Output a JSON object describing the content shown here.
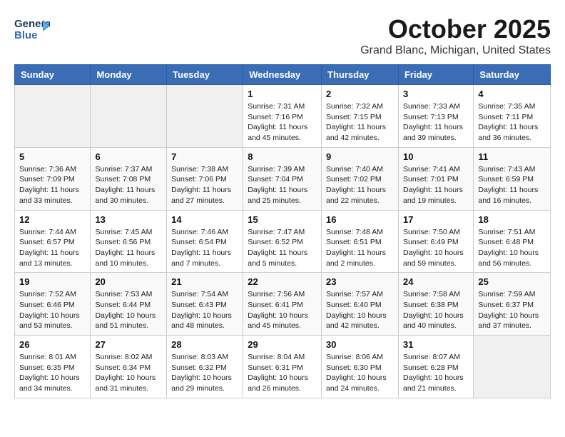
{
  "logo": {
    "line1": "General",
    "line2": "Blue"
  },
  "header": {
    "month": "October 2025",
    "location": "Grand Blanc, Michigan, United States"
  },
  "weekdays": [
    "Sunday",
    "Monday",
    "Tuesday",
    "Wednesday",
    "Thursday",
    "Friday",
    "Saturday"
  ],
  "weeks": [
    [
      {
        "day": "",
        "info": ""
      },
      {
        "day": "",
        "info": ""
      },
      {
        "day": "",
        "info": ""
      },
      {
        "day": "1",
        "info": "Sunrise: 7:31 AM\nSunset: 7:16 PM\nDaylight: 11 hours\nand 45 minutes."
      },
      {
        "day": "2",
        "info": "Sunrise: 7:32 AM\nSunset: 7:15 PM\nDaylight: 11 hours\nand 42 minutes."
      },
      {
        "day": "3",
        "info": "Sunrise: 7:33 AM\nSunset: 7:13 PM\nDaylight: 11 hours\nand 39 minutes."
      },
      {
        "day": "4",
        "info": "Sunrise: 7:35 AM\nSunset: 7:11 PM\nDaylight: 11 hours\nand 36 minutes."
      }
    ],
    [
      {
        "day": "5",
        "info": "Sunrise: 7:36 AM\nSunset: 7:09 PM\nDaylight: 11 hours\nand 33 minutes."
      },
      {
        "day": "6",
        "info": "Sunrise: 7:37 AM\nSunset: 7:08 PM\nDaylight: 11 hours\nand 30 minutes."
      },
      {
        "day": "7",
        "info": "Sunrise: 7:38 AM\nSunset: 7:06 PM\nDaylight: 11 hours\nand 27 minutes."
      },
      {
        "day": "8",
        "info": "Sunrise: 7:39 AM\nSunset: 7:04 PM\nDaylight: 11 hours\nand 25 minutes."
      },
      {
        "day": "9",
        "info": "Sunrise: 7:40 AM\nSunset: 7:02 PM\nDaylight: 11 hours\nand 22 minutes."
      },
      {
        "day": "10",
        "info": "Sunrise: 7:41 AM\nSunset: 7:01 PM\nDaylight: 11 hours\nand 19 minutes."
      },
      {
        "day": "11",
        "info": "Sunrise: 7:43 AM\nSunset: 6:59 PM\nDaylight: 11 hours\nand 16 minutes."
      }
    ],
    [
      {
        "day": "12",
        "info": "Sunrise: 7:44 AM\nSunset: 6:57 PM\nDaylight: 11 hours\nand 13 minutes."
      },
      {
        "day": "13",
        "info": "Sunrise: 7:45 AM\nSunset: 6:56 PM\nDaylight: 11 hours\nand 10 minutes."
      },
      {
        "day": "14",
        "info": "Sunrise: 7:46 AM\nSunset: 6:54 PM\nDaylight: 11 hours\nand 7 minutes."
      },
      {
        "day": "15",
        "info": "Sunrise: 7:47 AM\nSunset: 6:52 PM\nDaylight: 11 hours\nand 5 minutes."
      },
      {
        "day": "16",
        "info": "Sunrise: 7:48 AM\nSunset: 6:51 PM\nDaylight: 11 hours\nand 2 minutes."
      },
      {
        "day": "17",
        "info": "Sunrise: 7:50 AM\nSunset: 6:49 PM\nDaylight: 10 hours\nand 59 minutes."
      },
      {
        "day": "18",
        "info": "Sunrise: 7:51 AM\nSunset: 6:48 PM\nDaylight: 10 hours\nand 56 minutes."
      }
    ],
    [
      {
        "day": "19",
        "info": "Sunrise: 7:52 AM\nSunset: 6:46 PM\nDaylight: 10 hours\nand 53 minutes."
      },
      {
        "day": "20",
        "info": "Sunrise: 7:53 AM\nSunset: 6:44 PM\nDaylight: 10 hours\nand 51 minutes."
      },
      {
        "day": "21",
        "info": "Sunrise: 7:54 AM\nSunset: 6:43 PM\nDaylight: 10 hours\nand 48 minutes."
      },
      {
        "day": "22",
        "info": "Sunrise: 7:56 AM\nSunset: 6:41 PM\nDaylight: 10 hours\nand 45 minutes."
      },
      {
        "day": "23",
        "info": "Sunrise: 7:57 AM\nSunset: 6:40 PM\nDaylight: 10 hours\nand 42 minutes."
      },
      {
        "day": "24",
        "info": "Sunrise: 7:58 AM\nSunset: 6:38 PM\nDaylight: 10 hours\nand 40 minutes."
      },
      {
        "day": "25",
        "info": "Sunrise: 7:59 AM\nSunset: 6:37 PM\nDaylight: 10 hours\nand 37 minutes."
      }
    ],
    [
      {
        "day": "26",
        "info": "Sunrise: 8:01 AM\nSunset: 6:35 PM\nDaylight: 10 hours\nand 34 minutes."
      },
      {
        "day": "27",
        "info": "Sunrise: 8:02 AM\nSunset: 6:34 PM\nDaylight: 10 hours\nand 31 minutes."
      },
      {
        "day": "28",
        "info": "Sunrise: 8:03 AM\nSunset: 6:32 PM\nDaylight: 10 hours\nand 29 minutes."
      },
      {
        "day": "29",
        "info": "Sunrise: 8:04 AM\nSunset: 6:31 PM\nDaylight: 10 hours\nand 26 minutes."
      },
      {
        "day": "30",
        "info": "Sunrise: 8:06 AM\nSunset: 6:30 PM\nDaylight: 10 hours\nand 24 minutes."
      },
      {
        "day": "31",
        "info": "Sunrise: 8:07 AM\nSunset: 6:28 PM\nDaylight: 10 hours\nand 21 minutes."
      },
      {
        "day": "",
        "info": ""
      }
    ]
  ]
}
